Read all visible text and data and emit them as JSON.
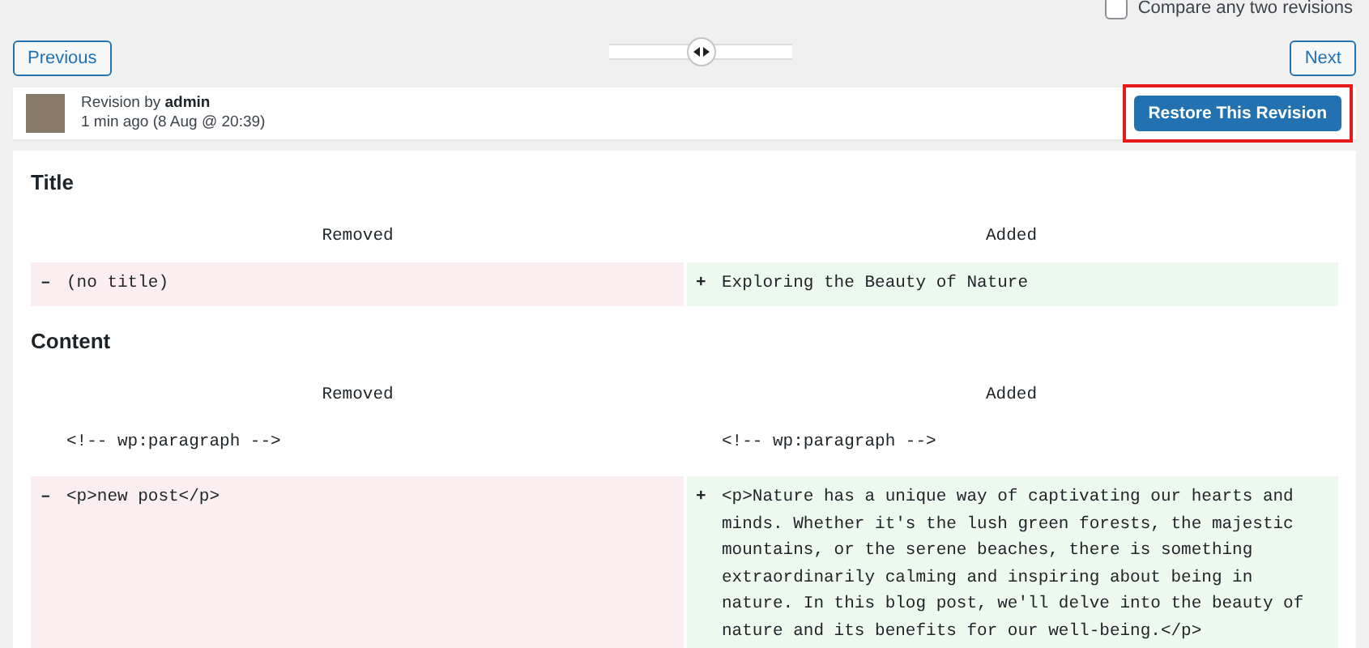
{
  "compare": {
    "label": "Compare any two revisions",
    "checked": false
  },
  "nav": {
    "previous": "Previous",
    "next": "Next",
    "slider": {
      "level": 0.5
    }
  },
  "revision": {
    "prefix": "Revision by",
    "author": "admin",
    "time": "1 min ago (8 Aug @ 20:39)",
    "restore": "Restore This Revision",
    "highlighted": true
  },
  "sections": [
    {
      "heading": "Title",
      "columns": [
        "Removed",
        "Added"
      ],
      "rows": [
        {
          "kind": "change",
          "removed": {
            "sign": "–",
            "text": "(no title)"
          },
          "added": {
            "sign": "+",
            "text": "Exploring the Beauty of Nature"
          }
        }
      ]
    },
    {
      "heading": "Content",
      "columns": [
        "Removed",
        "Added"
      ],
      "rows": [
        {
          "kind": "context",
          "removed": {
            "text": "<!-- wp:paragraph -->"
          },
          "added": {
            "text": "<!-- wp:paragraph -->"
          }
        },
        {
          "kind": "change",
          "removed": {
            "sign": "–",
            "text": "<p>new post</p>"
          },
          "added": {
            "sign": "+",
            "text": "<p>Nature has a unique way of captivating our hearts and minds. Whether it's the lush green forests, the majestic mountains, or the serene beaches, there is something extraordinarily calming and inspiring about being in nature. In this blog post, we'll delve into the beauty of nature and its benefits for our well-being.</p>"
          }
        }
      ]
    }
  ]
}
